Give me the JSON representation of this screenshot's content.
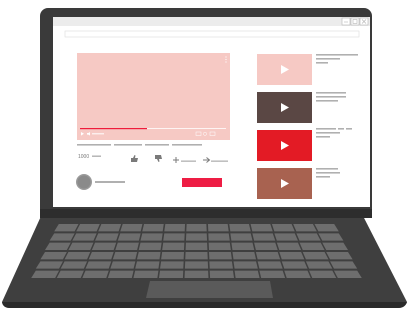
{
  "player": {
    "view_count": "1000"
  },
  "colors": {
    "laptop_body": "#3a3a3a",
    "laptop_base": "#4a4a4a",
    "keys": "#6e6e6e",
    "video_bg": "#f6c9c4",
    "progress_red": "#ef1c3c",
    "subscribe_red": "#ee1d44",
    "thumb_pink": "#f6c9c4",
    "thumb_dark": "#5a4744",
    "thumb_red": "#e31b25",
    "thumb_brown": "#a86250",
    "placeholder_gray": "#b0b0b0"
  },
  "sidebar": {
    "thumbnails": [
      {
        "name": "thumbnail-1",
        "color": "#f6c9c4"
      },
      {
        "name": "thumbnail-2",
        "color": "#5a4744"
      },
      {
        "name": "thumbnail-3",
        "color": "#e31b25"
      },
      {
        "name": "thumbnail-4",
        "color": "#a86250"
      }
    ]
  },
  "window_icons": [
    "minimize-icon",
    "maximize-icon",
    "close-icon"
  ],
  "player_icons": [
    "play-icon",
    "volume-icon",
    "settings-icon",
    "fullscreen-icon"
  ],
  "action_icons": [
    "like-icon",
    "dislike-icon",
    "add-to-playlist-icon",
    "share-icon"
  ]
}
